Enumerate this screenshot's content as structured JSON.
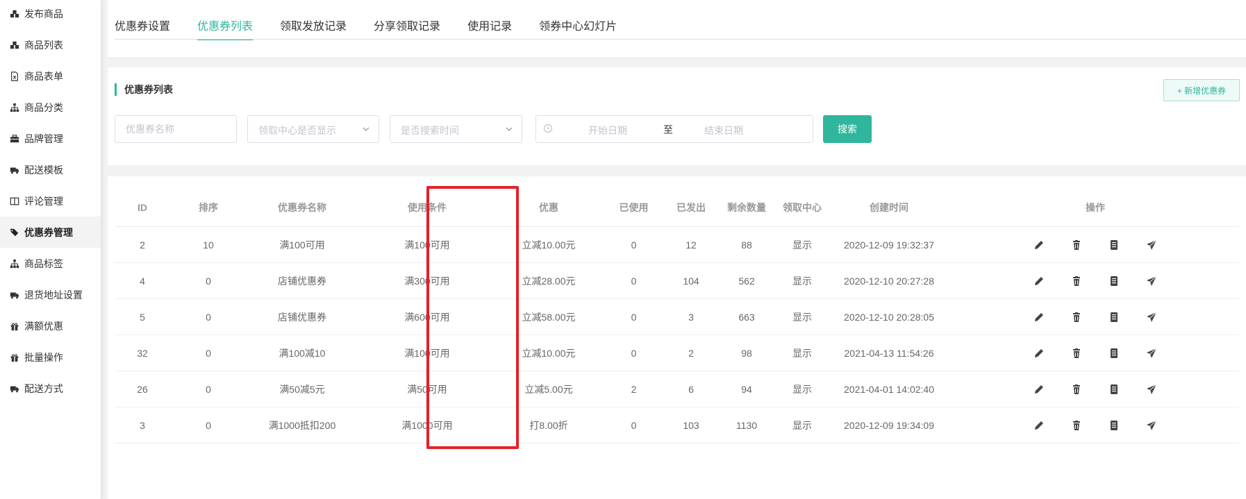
{
  "sidebar": {
    "items": [
      {
        "label": "发布商品",
        "icon": "cubes-icon"
      },
      {
        "label": "商品列表",
        "icon": "cubes-icon"
      },
      {
        "label": "商品表单",
        "icon": "excel-file-icon"
      },
      {
        "label": "商品分类",
        "icon": "sitemap-icon"
      },
      {
        "label": "品牌管理",
        "icon": "briefcase-icon"
      },
      {
        "label": "配送模板",
        "icon": "truck-icon"
      },
      {
        "label": "评论管理",
        "icon": "columns-icon"
      },
      {
        "label": "优惠券管理",
        "icon": "tags-icon",
        "active": true
      },
      {
        "label": "商品标签",
        "icon": "sitemap-icon"
      },
      {
        "label": "退货地址设置",
        "icon": "truck-icon"
      },
      {
        "label": "满额优惠",
        "icon": "gift-icon"
      },
      {
        "label": "批量操作",
        "icon": "gift-icon"
      },
      {
        "label": "配送方式",
        "icon": "truck-icon"
      }
    ]
  },
  "tabs": [
    {
      "label": "优惠券设置"
    },
    {
      "label": "优惠券列表",
      "active": true
    },
    {
      "label": "领取发放记录"
    },
    {
      "label": "分享领取记录"
    },
    {
      "label": "使用记录"
    },
    {
      "label": "领券中心幻灯片"
    }
  ],
  "filter": {
    "title": "优惠券列表",
    "add_button": "+ 新增优惠券",
    "name_placeholder": "优惠券名称",
    "center_select": "领取中心是否显示",
    "time_select": "是否搜索时间",
    "start_date": "开始日期",
    "date_sep": "至",
    "end_date": "结束日期",
    "search_button": "搜索"
  },
  "table": {
    "headers": [
      "ID",
      "排序",
      "优惠券名称",
      "使用条件",
      "优惠",
      "已使用",
      "已发出",
      "剩余数量",
      "领取中心",
      "创建时间",
      "操作"
    ],
    "rows": [
      [
        "2",
        "10",
        "满100可用",
        "满100可用",
        "立减10.00元",
        "0",
        "12",
        "88",
        "显示",
        "2020-12-09 19:32:37"
      ],
      [
        "4",
        "0",
        "店铺优惠券",
        "满300可用",
        "立减28.00元",
        "0",
        "104",
        "562",
        "显示",
        "2020-12-10 20:27:28"
      ],
      [
        "5",
        "0",
        "店铺优惠券",
        "满600可用",
        "立减58.00元",
        "0",
        "3",
        "663",
        "显示",
        "2020-12-10 20:28:05"
      ],
      [
        "32",
        "0",
        "满100减10",
        "满100可用",
        "立减10.00元",
        "0",
        "2",
        "98",
        "显示",
        "2021-04-13 11:54:26"
      ],
      [
        "26",
        "0",
        "满50减5元",
        "满50可用",
        "立减5.00元",
        "2",
        "6",
        "94",
        "显示",
        "2021-04-01 14:02:40"
      ],
      [
        "3",
        "0",
        "满1000抵扣200",
        "满1000可用",
        "打8.00折",
        "0",
        "103",
        "1130",
        "显示",
        "2020-12-09 19:34:09"
      ]
    ],
    "operations": [
      "edit-icon",
      "delete-icon",
      "copy-icon",
      "send-icon"
    ]
  },
  "colors": {
    "accent": "#2fb69c",
    "highlight": "#e32228"
  }
}
